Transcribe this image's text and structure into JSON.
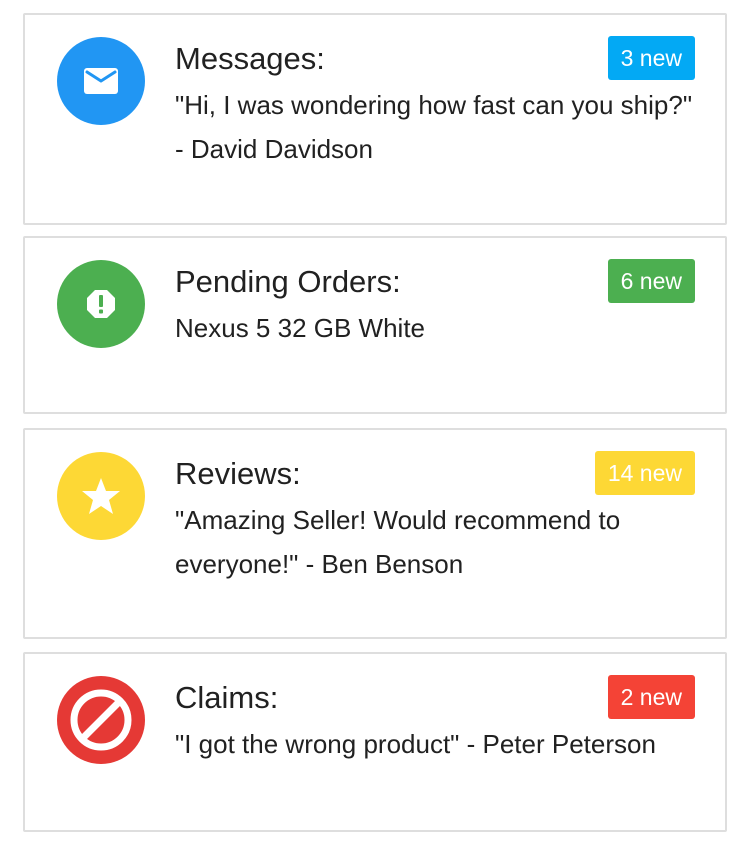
{
  "colors": {
    "messages": "#2196F3",
    "orders": "#4CAF50",
    "reviews": "#FDD835",
    "claims": "#E53935",
    "messages_badge": "#03A9F4",
    "orders_badge": "#4CAF50",
    "reviews_badge": "#FDD835",
    "claims_badge": "#F44336"
  },
  "cards": [
    {
      "icon": "envelope-icon",
      "title": "Messages:",
      "text": "\"Hi, I was wondering how fast can you ship?\" - David Davidson",
      "badge": "3 new"
    },
    {
      "icon": "alert-octagon-icon",
      "title": "Pending Orders:",
      "text": "Nexus 5 32 GB White",
      "badge": "6 new"
    },
    {
      "icon": "star-icon",
      "title": "Reviews:",
      "text": "\"Amazing Seller! Would recommend to everyone!\" - Ben Benson",
      "badge": "14 new"
    },
    {
      "icon": "block-icon",
      "title": "Claims:",
      "text": "\"I got the wrong product\" - Peter Peterson",
      "badge": "2 new"
    }
  ]
}
